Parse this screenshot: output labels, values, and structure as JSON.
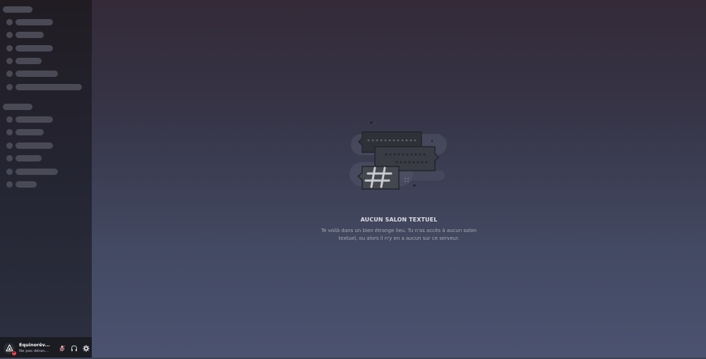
{
  "sidebar": {
    "state": "loading-skeleton",
    "user_panel": {
      "username": "Equinorêv...",
      "status_text": "Ne pas déran...",
      "status_color": "#ed4245",
      "avatar_icon": "triangle-logo-icon",
      "icons": [
        "mute-microphone-icon",
        "headphones-icon",
        "gear-icon"
      ]
    }
  },
  "main": {
    "empty_state": {
      "illustration_icon": "chat-bubbles-hashtag-icon",
      "title": "AUCUN SALON TEXTUEL",
      "description": "Te voilà dans un bien étrange lieu. Tu n'as accès à aucun salon textuel, ou alors il n'y en a aucun sur ce serveur."
    }
  },
  "colors": {
    "sidebar_bg": "#201c22",
    "main_bg_top": "#342a38",
    "main_bg_bottom": "#4b5270",
    "skeleton": "#4a4a56"
  }
}
